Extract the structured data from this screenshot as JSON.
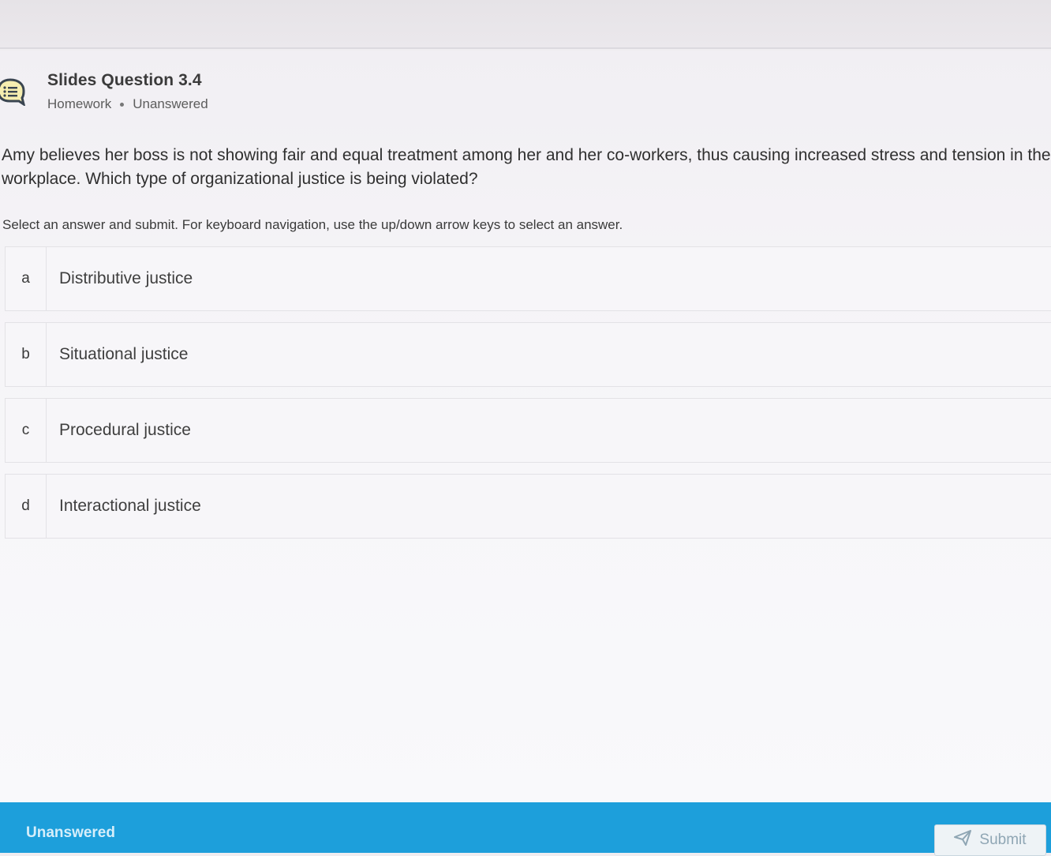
{
  "header": {
    "title": "Slides Question 3.4",
    "category": "Homework",
    "status": "Unanswered",
    "icon": "question-list-icon"
  },
  "question": {
    "text": "Amy believes her boss is not showing fair and equal treatment among her and her co-workers, thus causing increased stress and tension in the workplace.  Which type of organizational justice is being violated?"
  },
  "instructions": "Select an answer and submit. For keyboard navigation, use the up/down arrow keys to select an answer.",
  "options": [
    {
      "letter": "a",
      "label": "Distributive justice"
    },
    {
      "letter": "b",
      "label": "Situational justice"
    },
    {
      "letter": "c",
      "label": "Procedural justice"
    },
    {
      "letter": "d",
      "label": "Interactional justice"
    }
  ],
  "footer": {
    "status": "Unanswered",
    "submit_label": "Submit",
    "submit_icon": "paper-plane-icon"
  },
  "colors": {
    "footer_bg": "#1d9fdb",
    "page_bg": "#f6f5f8",
    "icon_color": "#3a4550"
  }
}
